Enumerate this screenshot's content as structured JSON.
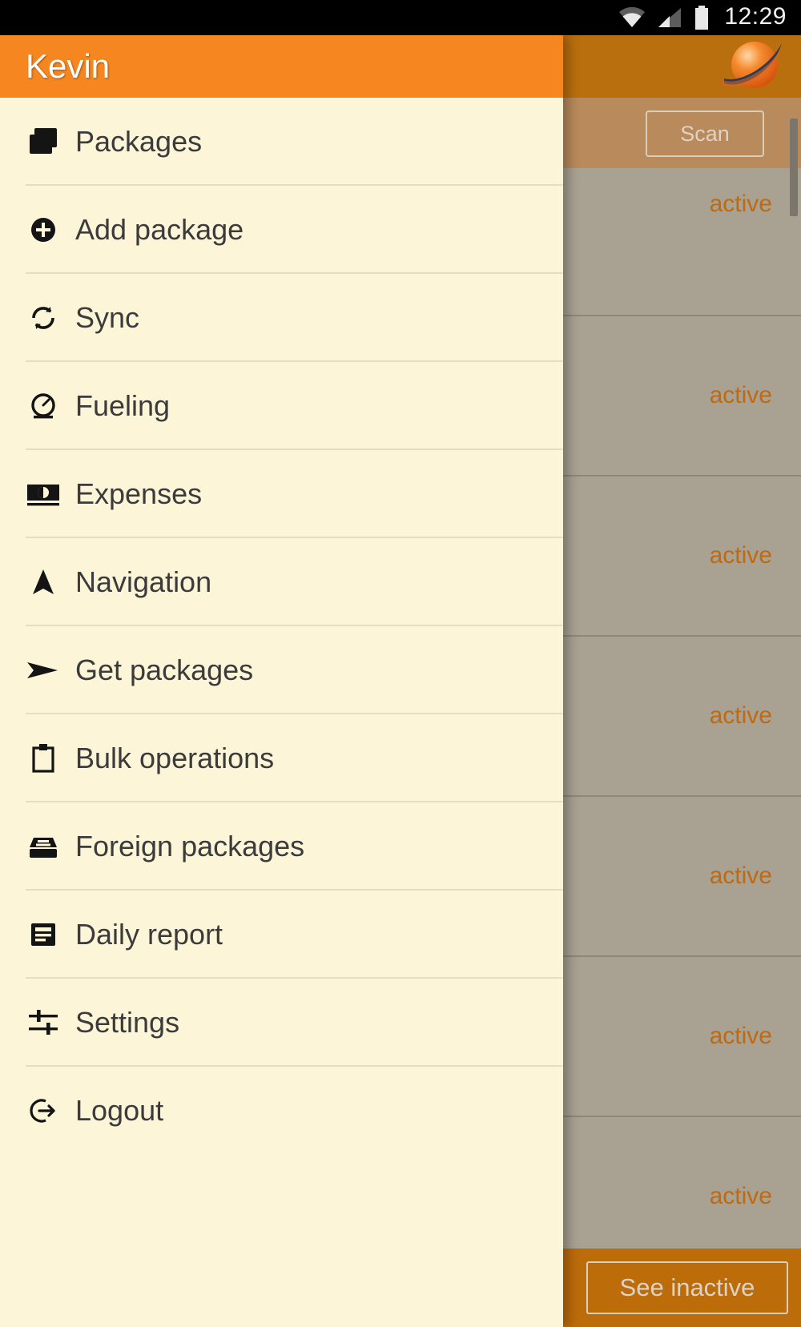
{
  "status_bar": {
    "time": "12:29",
    "icons": [
      "wifi-icon",
      "cellular-signal-icon",
      "battery-icon"
    ]
  },
  "drawer": {
    "username": "Kevin",
    "header_color": "#f6861f",
    "background_color": "#fdf5d8",
    "items": [
      {
        "label": "Packages",
        "icon": "packages-stack-icon"
      },
      {
        "label": "Add package",
        "icon": "plus-circle-icon"
      },
      {
        "label": "Sync",
        "icon": "sync-refresh-icon"
      },
      {
        "label": "Fueling",
        "icon": "fuel-gauge-icon"
      },
      {
        "label": "Expenses",
        "icon": "banknote-icon"
      },
      {
        "label": "Navigation",
        "icon": "navigation-arrow-icon"
      },
      {
        "label": "Get packages",
        "icon": "send-arrow-icon"
      },
      {
        "label": "Bulk operations",
        "icon": "clipboard-icon"
      },
      {
        "label": "Foreign packages",
        "icon": "inbox-archive-icon"
      },
      {
        "label": "Daily report",
        "icon": "report-document-icon"
      },
      {
        "label": "Settings",
        "icon": "sliders-icon"
      },
      {
        "label": "Logout",
        "icon": "logout-exit-icon"
      }
    ]
  },
  "content": {
    "app_bar": {
      "logo": "planet-swoosh-logo",
      "color": "#b96f0d"
    },
    "toolbar": {
      "scan_label": "Scan"
    },
    "package_rows": [
      {
        "state": "active"
      },
      {
        "state": "active"
      },
      {
        "state": "active"
      },
      {
        "state": "active"
      },
      {
        "state": "active"
      },
      {
        "state": "active"
      },
      {
        "state": "active"
      }
    ],
    "bottom_bar": {
      "see_inactive_label": "See inactive"
    },
    "accent_color": "#c0690e"
  }
}
